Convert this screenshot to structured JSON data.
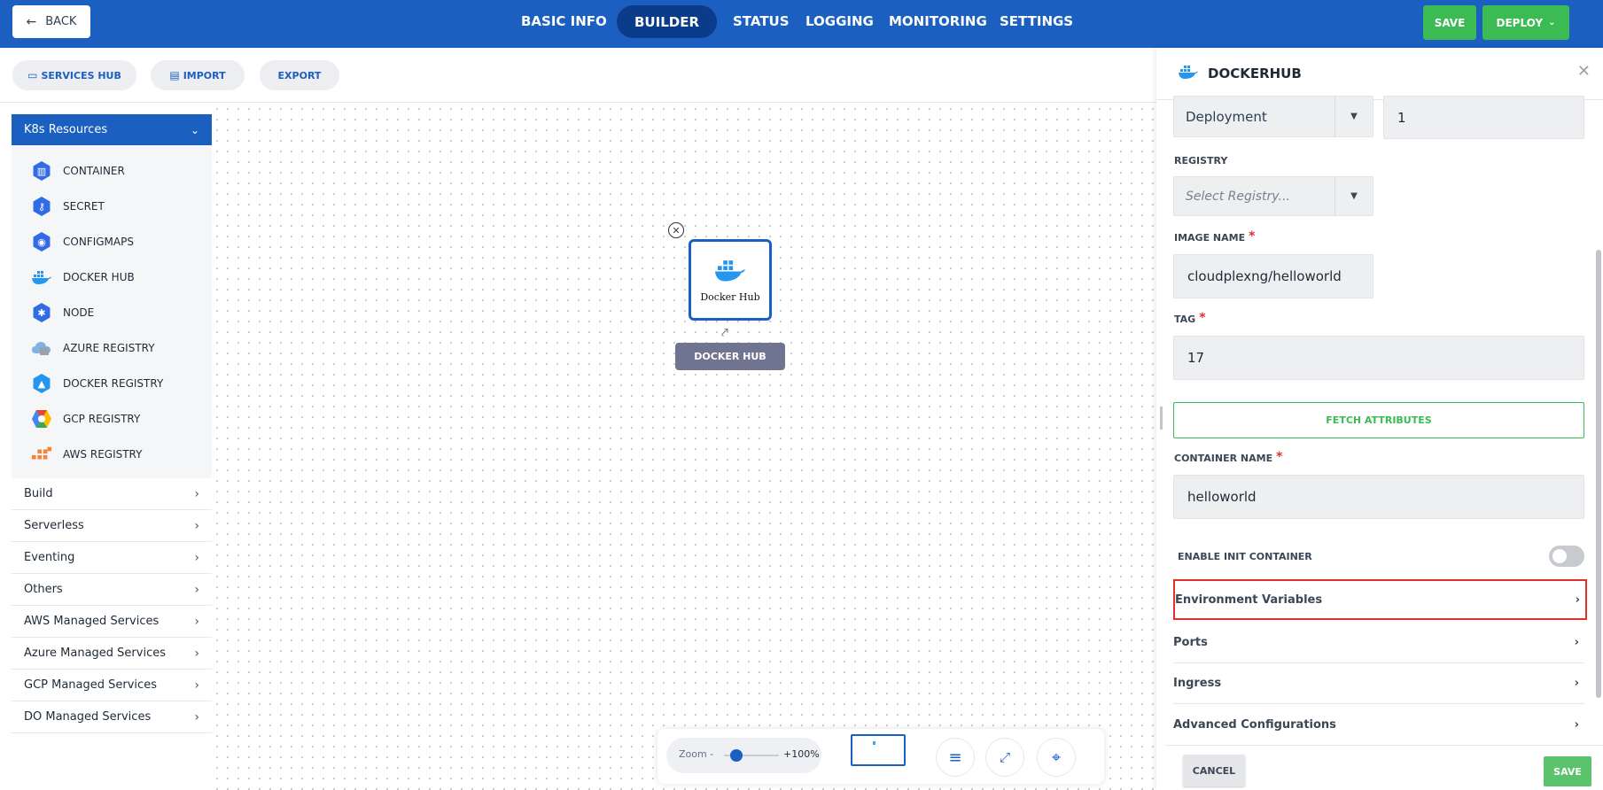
{
  "header": {
    "back_label": "BACK",
    "nav": [
      {
        "label": "BASIC INFO"
      },
      {
        "label": "BUILDER"
      },
      {
        "label": "STATUS"
      },
      {
        "label": "LOGGING"
      },
      {
        "label": "MONITORING"
      },
      {
        "label": "SETTINGS"
      }
    ],
    "active_nav": "BUILDER",
    "save_label": "SAVE",
    "deploy_label": "DEPLOY",
    "primary_color": "#1b5fc1",
    "success_color": "#3cba54"
  },
  "toolbar": {
    "services_hub_label": "SERVICES HUB",
    "import_label": "IMPORT",
    "export_label": "EXPORT"
  },
  "sidebar": {
    "section_title": "K8s Resources",
    "resources": [
      {
        "label": "CONTAINER",
        "icon": "container-icon"
      },
      {
        "label": "SECRET",
        "icon": "secret-icon"
      },
      {
        "label": "CONFIGMAPS",
        "icon": "configmap-icon"
      },
      {
        "label": "DOCKER HUB",
        "icon": "docker-icon"
      },
      {
        "label": "NODE",
        "icon": "node-icon"
      },
      {
        "label": "AZURE REGISTRY",
        "icon": "azure-registry-icon"
      },
      {
        "label": "DOCKER REGISTRY",
        "icon": "docker-registry-icon"
      },
      {
        "label": "GCP REGISTRY",
        "icon": "gcp-registry-icon"
      },
      {
        "label": "AWS REGISTRY",
        "icon": "aws-registry-icon"
      }
    ],
    "categories": [
      {
        "label": "Build"
      },
      {
        "label": "Serverless"
      },
      {
        "label": "Eventing"
      },
      {
        "label": "Others"
      },
      {
        "label": "AWS Managed Services"
      },
      {
        "label": "Azure Managed Services"
      },
      {
        "label": "GCP Managed Services"
      },
      {
        "label": "DO Managed Services"
      }
    ]
  },
  "canvas": {
    "node_label": "Docker Hub",
    "node_tag": "DOCKER HUB",
    "zoom_label": "Zoom -",
    "zoom_value": "+100%"
  },
  "panel": {
    "title": "DOCKERHUB",
    "kind_value": "Deployment",
    "replicas_value": "1",
    "registry_label": "REGISTRY",
    "registry_placeholder": "Select Registry...",
    "image_name_label": "IMAGE NAME",
    "image_name_value": "cloudplexng/helloworld",
    "tag_label": "TAG",
    "tag_value": "17",
    "fetch_label": "FETCH ATTRIBUTES",
    "container_name_label": "CONTAINER NAME",
    "container_name_value": "helloworld",
    "init_container_label": "ENABLE INIT CONTAINER",
    "init_container_enabled": false,
    "sections": [
      {
        "label": "Environment Variables"
      },
      {
        "label": "Ports"
      },
      {
        "label": "Ingress"
      },
      {
        "label": "Advanced Configurations"
      }
    ],
    "cancel_label": "CANCEL",
    "save_label": "SAVE",
    "highlight_color": "#e0312a"
  }
}
